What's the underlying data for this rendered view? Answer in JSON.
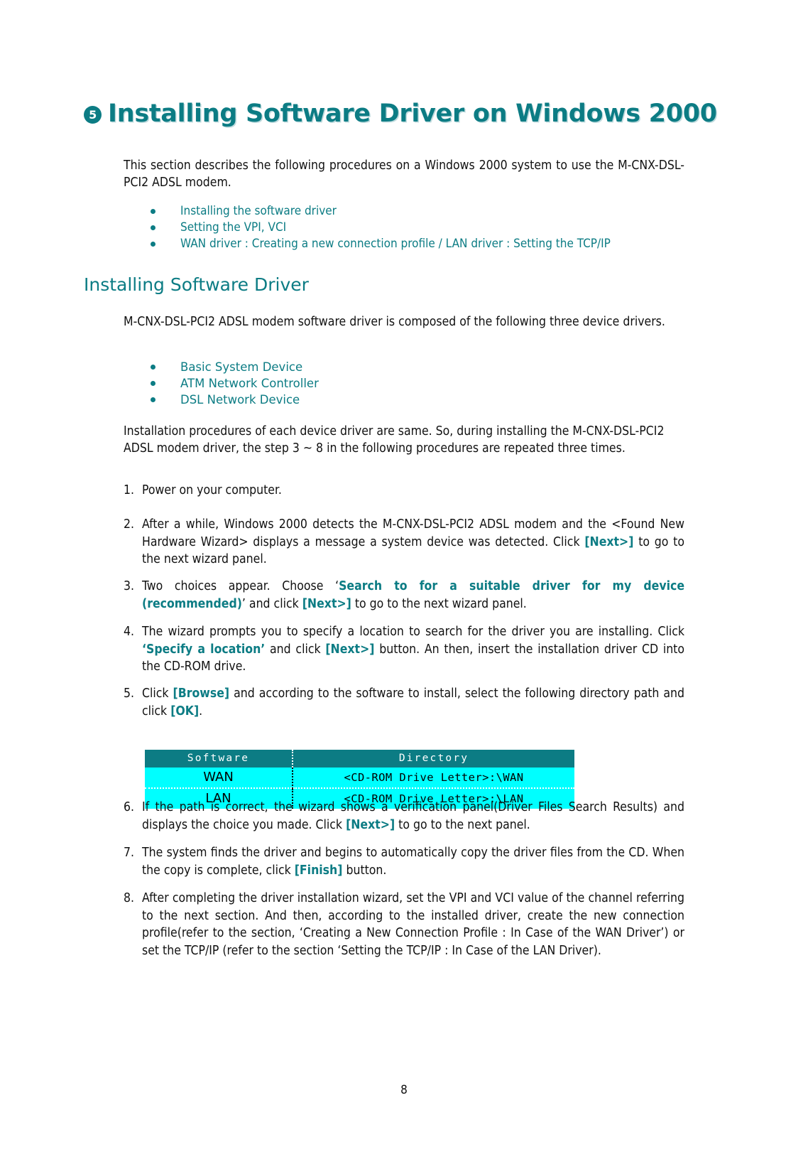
{
  "document": {
    "page_number": "8"
  },
  "chapter": {
    "number_glyph": "5",
    "title": "Installing Software Driver on Windows 2000",
    "accent_color": "#0C7C84"
  },
  "intro": {
    "paragraph": "This section describes the following procedures on a Windows 2000 system to use the M-CNX-DSL-PCI2 ADSL modem.",
    "bullets": [
      "Installing the software driver",
      "Setting the VPI, VCI",
      "WAN driver : Creating a new connection profile / LAN driver : Setting the TCP/IP"
    ]
  },
  "section": {
    "heading": "Installing Software Driver",
    "paragraph": "M-CNX-DSL-PCI2 ADSL modem software driver is composed of the following three device drivers.",
    "bullets": [
      "Basic System Device",
      "ATM Network Controller",
      "DSL Network Device"
    ],
    "note": "Installation procedures of each device driver are same. So, during installing the M-CNX-DSL-PCI2 ADSL modem driver, the step 3 ~ 8 in the following procedures are repeated three times."
  },
  "steps": [
    {
      "num": "1.",
      "parts": [
        {
          "t": "Power on your computer.",
          "style": "normal"
        }
      ]
    },
    {
      "num": "2.",
      "parts": [
        {
          "t": "After a while, Windows 2000 detects the M-CNX-DSL-PCI2 ADSL modem and the <Found New Hardware Wizard> displays a message a system device was detected. Click ",
          "style": "normal"
        },
        {
          "t": "[Next>]",
          "style": "key"
        },
        {
          "t": " to go to the next wizard panel.",
          "style": "normal"
        }
      ]
    },
    {
      "num": "3.",
      "parts": [
        {
          "t": "Two choices appear. Choose ‘",
          "style": "normal"
        },
        {
          "t": "Search to for a suitable driver for my device (recommended)",
          "style": "key"
        },
        {
          "t": "’ and click ",
          "style": "normal"
        },
        {
          "t": "[Next>]",
          "style": "key"
        },
        {
          "t": " to go to the next wizard panel.",
          "style": "normal"
        }
      ]
    },
    {
      "num": "4.",
      "parts": [
        {
          "t": "The wizard prompts you to specify a location to search for the driver you are installing. Click ",
          "style": "normal"
        },
        {
          "t": "‘Specify a location’",
          "style": "key"
        },
        {
          "t": " and click ",
          "style": "normal"
        },
        {
          "t": "[Next>]",
          "style": "key"
        },
        {
          "t": " button. An then, insert the installation driver CD into the CD-ROM drive.",
          "style": "normal"
        }
      ]
    },
    {
      "num": "5.",
      "parts": [
        {
          "t": "Click ",
          "style": "normal"
        },
        {
          "t": "[Browse]",
          "style": "key"
        },
        {
          "t": " and according to the software to install, select the following directory path and click ",
          "style": "normal"
        },
        {
          "t": "[OK]",
          "style": "key"
        },
        {
          "t": ".",
          "style": "normal"
        }
      ]
    },
    {
      "num": "6.",
      "parts": [
        {
          "t": "If the path is correct, the wizard shows a verification panel(Driver Files Search Results) and displays the choice you made. Click ",
          "style": "normal"
        },
        {
          "t": "[Next>]",
          "style": "key"
        },
        {
          "t": " to go to the next panel.",
          "style": "normal"
        }
      ]
    },
    {
      "num": "7.",
      "parts": [
        {
          "t": "The system finds the driver and begins to automatically copy the driver files from the CD. When the copy is complete, click ",
          "style": "normal"
        },
        {
          "t": "[Finish]",
          "style": "key"
        },
        {
          "t": " button.",
          "style": "normal"
        }
      ]
    },
    {
      "num": "8.",
      "parts": [
        {
          "t": "After completing the driver installation wizard, set the VPI and VCI value of the channel referring to the next section. And then, according to the installed driver, create the new connection profile(refer to the section, ‘Creating a New Connection Profile : In Case of the WAN Driver’) or set the TCP/IP (refer to the section ‘Setting the TCP/IP : In Case of the LAN Driver).",
          "style": "normal"
        }
      ]
    }
  ],
  "table": {
    "header_bg": "#0C7C84",
    "body_bg": "#00FFFF",
    "columns": [
      "Software",
      "Directory"
    ],
    "rows": [
      {
        "software": "WAN",
        "directory": "<CD-ROM Drive Letter>:\\WAN"
      },
      {
        "software": "LAN",
        "directory": "<CD-ROM Drive Letter>:\\LAN"
      }
    ]
  }
}
